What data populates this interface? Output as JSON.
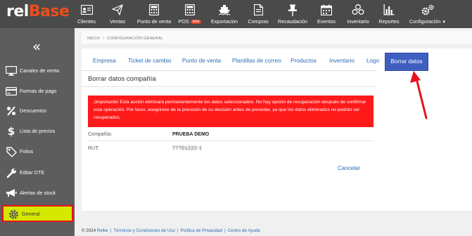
{
  "brand": {
    "logo_part1": "rel",
    "logo_part2": "Base",
    "accent_color": "#e9501d"
  },
  "topnav": {
    "items": [
      {
        "label": "Clientes",
        "icon": "address-card-icon"
      },
      {
        "label": "Ventas",
        "icon": "paper-plane-icon"
      },
      {
        "label": "Punto de venta",
        "icon": "calculator-icon"
      },
      {
        "label": "POS",
        "badge": "beta",
        "icon": "calculator-icon"
      },
      {
        "label": "Exportación",
        "icon": "ship-icon"
      },
      {
        "label": "Compras",
        "icon": "document-icon"
      },
      {
        "label": "Recaudación",
        "icon": "pin-icon"
      },
      {
        "label": "Eventos",
        "icon": "calendar-icon"
      },
      {
        "label": "Inventario",
        "icon": "boxes-icon"
      },
      {
        "label": "Reportes",
        "icon": "bar-chart-icon"
      },
      {
        "label": "Configuración",
        "icon": "gears-icon"
      }
    ]
  },
  "sidebar": {
    "collapse_glyph": "«",
    "items": [
      {
        "label": "Canales de venta",
        "icon": "monitor-icon"
      },
      {
        "label": "Formas de pago",
        "icon": "credit-card-icon"
      },
      {
        "label": "Descuentos",
        "icon": "percent-icon"
      },
      {
        "label": "Lista de precios",
        "icon": "dollar-icon"
      },
      {
        "label": "Folios",
        "icon": "tag-icon"
      },
      {
        "label": "Editar DTE",
        "icon": "wrench-icon"
      },
      {
        "label": "Alertas de stock",
        "icon": "bullhorn-icon"
      },
      {
        "label": "General",
        "icon": "gear-icon",
        "active": true
      }
    ],
    "highlight_color": "#d4e800",
    "highlight_border": "#e8121e"
  },
  "breadcrumb": {
    "home": "INICIO",
    "separator": "/",
    "current": "CONFIGURACIÓN GENERAL"
  },
  "tabs": [
    {
      "label": "Empresa"
    },
    {
      "label": "Ticket de cambio"
    },
    {
      "label": "Punto de venta"
    },
    {
      "label": "Plantillas de correo"
    },
    {
      "label": "Productos"
    },
    {
      "label": "Inventario"
    },
    {
      "label": "Logo"
    },
    {
      "label": "Borrar datos",
      "active": true
    }
  ],
  "section": {
    "title": "Borrar datos compañía",
    "alert_text": "¡Importante! Esta acción eliminará permanentemente los datos seleccionados. No hay opción de recuperación después de confirmar esta operación. Por favor, asegúrese de la precisión de su decisión antes de proceder, ya que los datos eliminados no podrán ser recuperados.",
    "alert_color": "#ff1a1a",
    "fields": [
      {
        "label": "Compañía:",
        "value": "PRUEBA DEMO"
      },
      {
        "label": "RUT:",
        "value": "77701222-1"
      }
    ],
    "cancel_label": "Cancelar"
  },
  "footer": {
    "copyright": "© 2024",
    "brand_link": "Relke",
    "links": [
      "Términos y Condiciones de Uso",
      "Política de Privacidad",
      "Centro de Ayuda"
    ],
    "separator": "|"
  },
  "annotation": {
    "arrow_color": "#e8121e"
  }
}
